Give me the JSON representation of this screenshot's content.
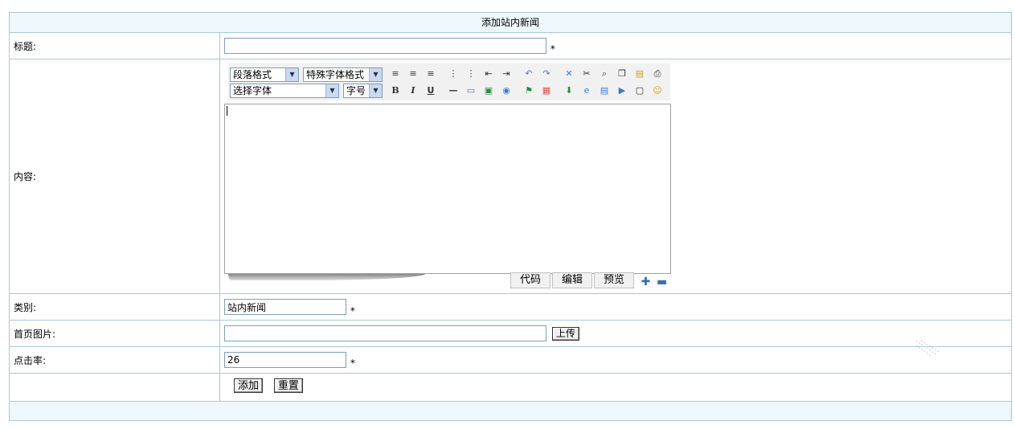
{
  "header": {
    "title": "添加站内新闻"
  },
  "fields": {
    "title": {
      "label": "标题:",
      "value": "",
      "required_mark": "*"
    },
    "content": {
      "label": "内容:"
    },
    "category": {
      "label": "类别:",
      "value": "站内新闻",
      "required_mark": "*"
    },
    "home_image": {
      "label": "首页图片:",
      "value": "",
      "upload_label": "上传"
    },
    "hits": {
      "label": "点击率:",
      "value": "26",
      "required_mark": "*"
    }
  },
  "editor": {
    "paragraph_format": "段落格式",
    "special_font_format": "特殊字体格式",
    "font_select": "选择字体",
    "font_size": "字号",
    "bold": "B",
    "italic": "I",
    "underline": "U",
    "tabs": {
      "code": "代码",
      "edit": "编辑",
      "preview": "预览"
    }
  },
  "actions": {
    "add_label": "添加",
    "reset_label": "重置"
  },
  "colors": {
    "border": "#a9c7d8",
    "header_bg": "#eef7fb",
    "toolbar_bg": "#f1f1f1"
  }
}
